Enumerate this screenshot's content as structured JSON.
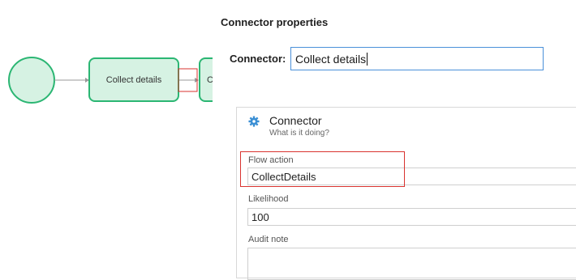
{
  "diagram": {
    "task_label": "Collect details",
    "next_task_label": "C"
  },
  "properties": {
    "title": "Connector properties",
    "connector_label": "Connector:",
    "connector_value": "Collect details"
  },
  "panel": {
    "title": "Connector",
    "subtitle": "What is it doing?",
    "fields": [
      {
        "label": "Flow action",
        "value": "CollectDetails"
      },
      {
        "label": "Likelihood",
        "value": "100"
      },
      {
        "label": "Audit note",
        "value": ""
      }
    ]
  },
  "colors": {
    "shape_fill": "#d6f2e3",
    "shape_stroke": "#2bb673",
    "highlight": "#d9332f",
    "input_focus": "#4a90d9",
    "gear": "#3b8fd4"
  }
}
